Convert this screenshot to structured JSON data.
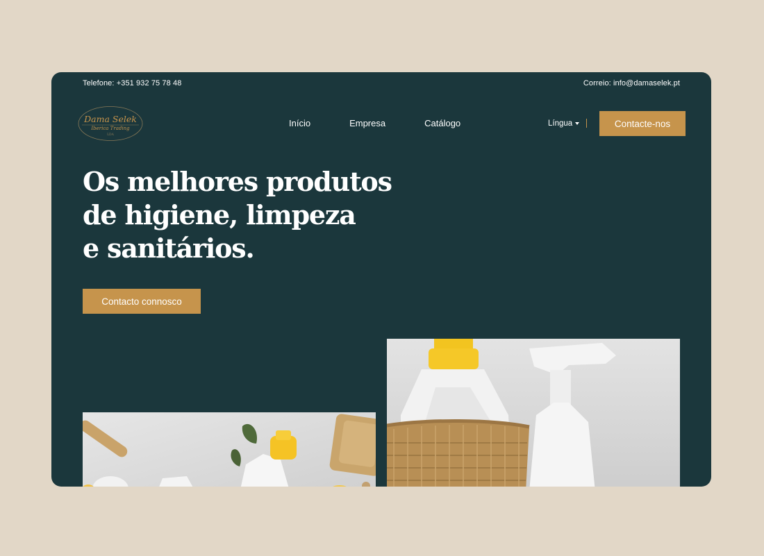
{
  "topbar": {
    "phone": "Telefone: +351 932 75 78 48",
    "email": "Correio: info@damaselek.pt"
  },
  "logo": {
    "name": "Dama Selek",
    "subtitle": "Iberica Trading",
    "suffix": "LDA"
  },
  "nav": {
    "items": [
      "Início",
      "Empresa",
      "Catálogo"
    ]
  },
  "language": {
    "label": "Língua"
  },
  "header": {
    "contact_button": "Contacte-nos"
  },
  "hero": {
    "title_lines": [
      "Os melhores produtos",
      "de higiene, limpeza",
      "e sanitários."
    ],
    "cta_button": "Contacto connosco"
  },
  "colors": {
    "page_background": "#e2d7c7",
    "panel": "#1b373c",
    "accent": "#c6944c",
    "text": "#ffffff"
  }
}
